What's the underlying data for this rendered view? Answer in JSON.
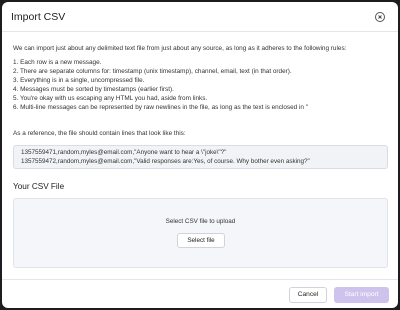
{
  "dialog": {
    "title": "Import CSV"
  },
  "intro": "We can import just about any delimited text file from just about any source, as long as it adheres to the following rules:",
  "rules": [
    "1. Each row is a new message.",
    "2. There are separate columns for: timestamp (unix timestamp), channel, email, text (in that order).",
    "3. Everything is in a single, uncompressed file.",
    "4. Messages must be sorted by timestamps (earlier first).",
    "5. You're okay with us escaping any HTML you had, aside from links.",
    "6. Multi-line messages can be represented by raw newlines in the file, as long as the text is enclosed in \""
  ],
  "reference": "As a reference, the file should contain lines that look like this:",
  "example_lines": [
    "1357559471,random,myles@email.com,\"Anyone want to hear a \\\"joke\\\"?\"",
    "1357559472,random,myles@email.com,\"Valid responses are:Yes, of course. Why bother even asking?\""
  ],
  "upload": {
    "section_title": "Your CSV File",
    "prompt": "Select CSV file to upload",
    "select_label": "Select file"
  },
  "footer": {
    "cancel_label": "Cancel",
    "start_label": "Start import"
  },
  "colors": {
    "accent_disabled": "#cdc3ec",
    "backdrop": "#1d1d1f"
  },
  "icons": {
    "close": "close-circle-icon"
  }
}
